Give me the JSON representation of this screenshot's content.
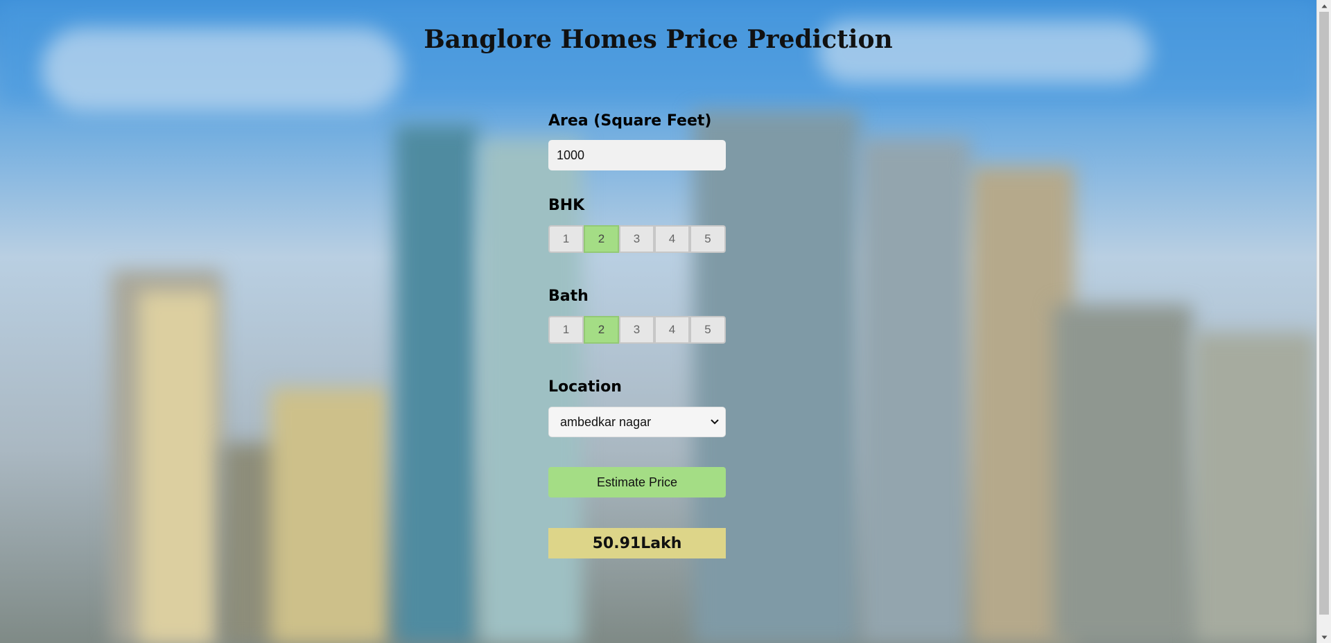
{
  "page": {
    "title": "Banglore Homes Price Prediction"
  },
  "form": {
    "area": {
      "label": "Area (Square Feet)",
      "value": "1000"
    },
    "bhk": {
      "label": "BHK",
      "options": [
        "1",
        "2",
        "3",
        "4",
        "5"
      ],
      "selected": "2"
    },
    "bath": {
      "label": "Bath",
      "options": [
        "1",
        "2",
        "3",
        "4",
        "5"
      ],
      "selected": "2"
    },
    "location": {
      "label": "Location",
      "selected": "ambedkar nagar"
    },
    "estimate_button": "Estimate Price",
    "result": "50.91Lakh"
  },
  "colors": {
    "selected_option": "#a4dd85",
    "button": "#a4dd85",
    "result_background": "#ddd589"
  },
  "icons": {
    "select_arrow": "chevron-down-icon",
    "scroll_up": "scroll-up-arrow-icon",
    "scroll_down": "scroll-down-arrow-icon"
  }
}
